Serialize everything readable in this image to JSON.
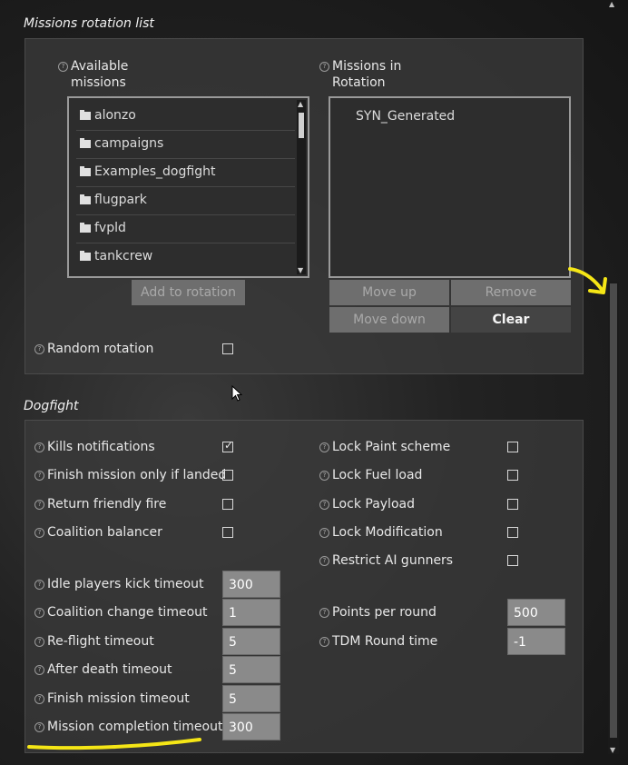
{
  "rotation": {
    "title": "Missions rotation list",
    "available_label_1": "Available",
    "available_label_2": "missions",
    "in_rotation_label_1": "Missions in",
    "in_rotation_label_2": "Rotation",
    "available_items": [
      "alonzo",
      "campaigns",
      "Examples_dogfight",
      "flugpark",
      "fvpld",
      "tankcrew"
    ],
    "rotation_items": [
      "SYN_Generated"
    ],
    "add_button": "Add to rotation",
    "move_up": "Move up",
    "remove": "Remove",
    "move_down": "Move down",
    "clear": "Clear",
    "random_rotation": "Random rotation",
    "random_rotation_checked": false
  },
  "dogfight": {
    "title": "Dogfight",
    "left_checks": [
      {
        "label": "Kills notifications",
        "checked": true
      },
      {
        "label": "Finish mission only if landed",
        "checked": false
      },
      {
        "label": "Return friendly fire",
        "checked": false
      },
      {
        "label": "Coalition balancer",
        "checked": false
      }
    ],
    "right_checks": [
      {
        "label": "Lock Paint scheme",
        "checked": false
      },
      {
        "label": "Lock Fuel load",
        "checked": false
      },
      {
        "label": "Lock Payload",
        "checked": false
      },
      {
        "label": "Lock Modification",
        "checked": false
      },
      {
        "label": "Restrict AI gunners",
        "checked": false
      }
    ],
    "left_timeouts": [
      {
        "label": "Idle players kick timeout",
        "value": "300"
      },
      {
        "label": "Coalition change timeout",
        "value": "1"
      },
      {
        "label": "Re-flight timeout",
        "value": "5"
      },
      {
        "label": "After death timeout",
        "value": "5"
      },
      {
        "label": "Finish mission timeout",
        "value": "5"
      },
      {
        "label": "Mission completion timeout",
        "value": "300"
      }
    ],
    "right_values": [
      {
        "label": "Points per round",
        "value": "500"
      },
      {
        "label": "TDM Round time",
        "value": "-1"
      }
    ]
  },
  "annotations": {
    "highlight_color": "#f5e616"
  },
  "icons": {
    "help": "question-circle-icon",
    "folder": "folder-icon",
    "check": "check-icon"
  }
}
